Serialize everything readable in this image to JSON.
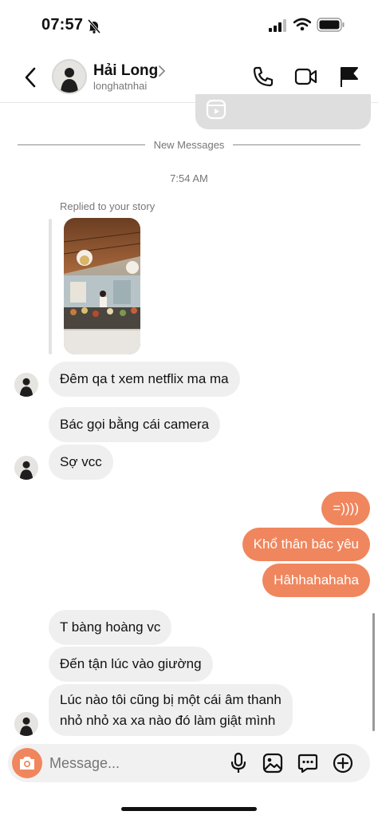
{
  "status_bar": {
    "time": "07:57"
  },
  "header": {
    "name": "Hải Long",
    "username": "longhatnhai"
  },
  "thread": {
    "new_messages_label": "New Messages",
    "timestamp": "7:54 AM",
    "reply_label": "Replied to your story",
    "incoming_group_1": [
      "Đêm qa t xem netflix ma ma"
    ],
    "incoming_group_2": [
      "Bác gọi bằng cái camera",
      "Sợ vcc"
    ],
    "outgoing_group": [
      "=))))",
      "Khổ thân bác yêu",
      "Hâhhahahaha"
    ],
    "incoming_group_3": [
      "T bàng hoàng vc",
      "Đến tận lúc vào giường"
    ],
    "incoming_long_line1": "Lúc nào tôi cũng bị một cái âm thanh",
    "incoming_long_line2": "nhỏ nhỏ xa xa nào đó làm giật mình"
  },
  "composer": {
    "placeholder": "Message..."
  },
  "colors": {
    "accent": "#f0865e",
    "incoming_bubble": "#efefef"
  }
}
